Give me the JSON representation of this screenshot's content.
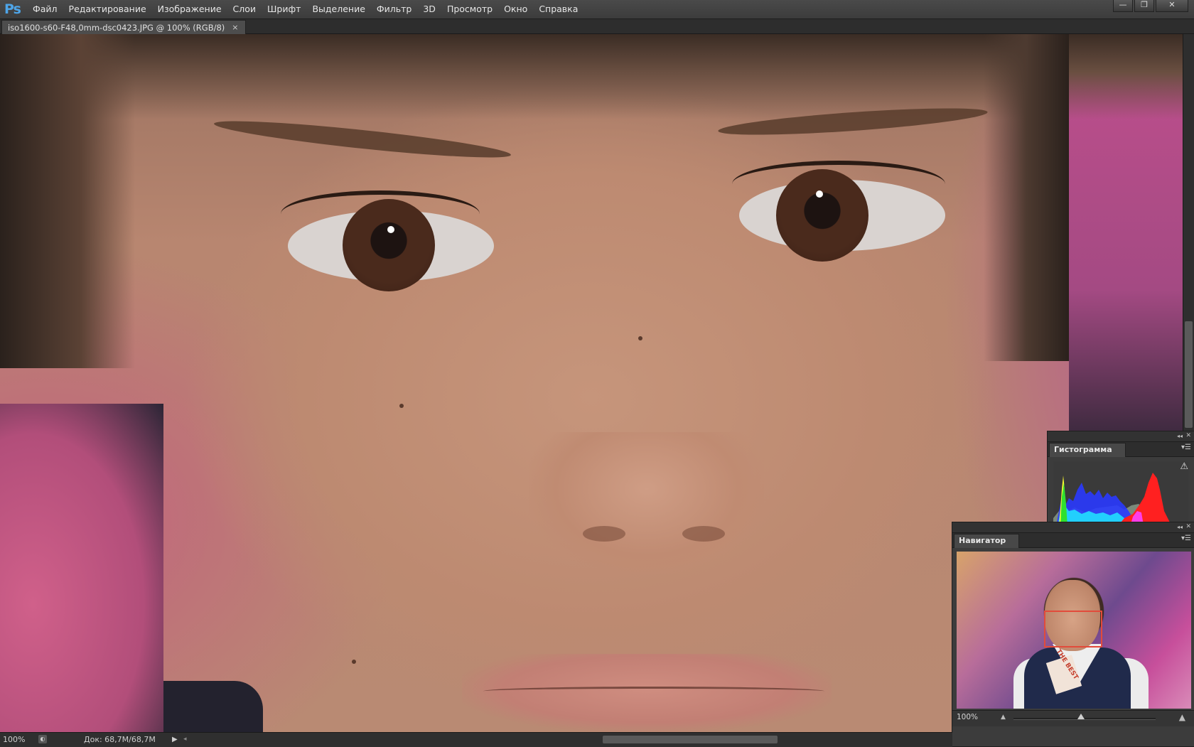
{
  "app": {
    "logo": "Ps",
    "menu": [
      "Файл",
      "Редактирование",
      "Изображение",
      "Слои",
      "Шрифт",
      "Выделение",
      "Фильтр",
      "3D",
      "Просмотр",
      "Окно",
      "Справка"
    ],
    "window_controls": {
      "minimize": "—",
      "restore": "❐",
      "close": "✕"
    }
  },
  "document": {
    "tab_title": "iso1600-s60-F48,0mm-dsc0423.JPG @ 100% (RGB/8)",
    "tab_close": "×"
  },
  "status": {
    "zoom": "100%",
    "doc_info": "Док: 68,7M/68,7M",
    "arrow": "▶",
    "scroll_left": "◂"
  },
  "histogram": {
    "tab": "Гистограмма",
    "warning_icon": "⚠",
    "channels": [
      "red",
      "green",
      "blue"
    ],
    "colors": {
      "red": "#ff2020",
      "green": "#30e030",
      "blue": "#2a3aff",
      "cyan": "#20e8ff",
      "magenta": "#ff40ff",
      "yellow": "#ffff30",
      "gray": "#7b8a7b"
    }
  },
  "navigator": {
    "tab": "Навигатор",
    "zoom": "100%",
    "badge_text": "THE BEST",
    "viewbox_color": "#e24b3b"
  },
  "panel_controls": {
    "collapse": "◂◂",
    "close": "✕",
    "menu": "▾☰"
  }
}
